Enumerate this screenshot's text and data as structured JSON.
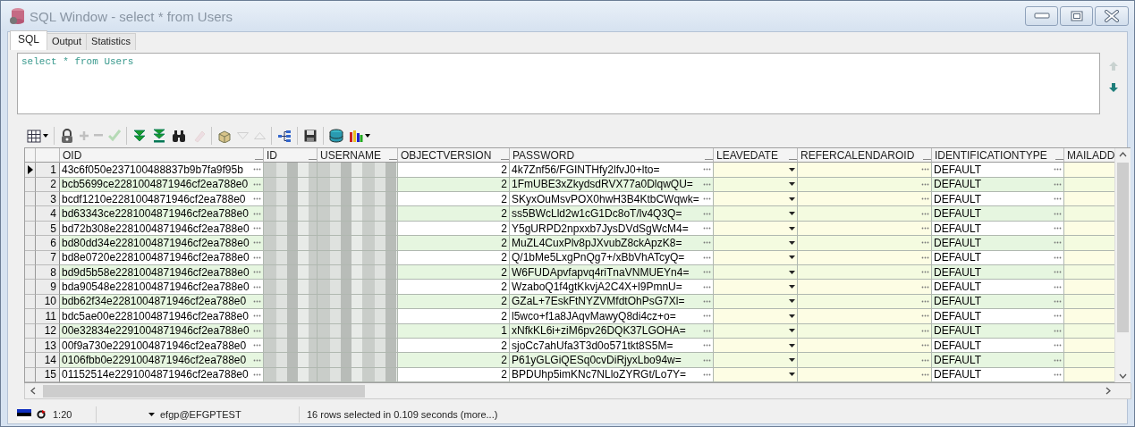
{
  "window": {
    "title": "SQL Window - select * from Users"
  },
  "tabs": [
    {
      "label": "SQL",
      "selected": true
    },
    {
      "label": "Output",
      "selected": false
    },
    {
      "label": "Statistics",
      "selected": false
    }
  ],
  "editor": {
    "value": "select * from Users"
  },
  "toolbar": [
    {
      "kind": "grid",
      "disabled": false
    },
    {
      "kind": "lock",
      "disabled": false
    },
    {
      "kind": "add",
      "disabled": true
    },
    {
      "kind": "remove",
      "disabled": true
    },
    {
      "kind": "post",
      "disabled": true
    },
    {
      "kind": "fetch-next",
      "disabled": false
    },
    {
      "kind": "fetch-last",
      "disabled": false
    },
    {
      "kind": "find",
      "disabled": false
    },
    {
      "kind": "clear",
      "disabled": true
    },
    {
      "kind": "export",
      "disabled": false
    },
    {
      "kind": "down",
      "disabled": true
    },
    {
      "kind": "up",
      "disabled": true
    },
    {
      "kind": "tree",
      "disabled": false
    },
    {
      "kind": "save",
      "disabled": false
    },
    {
      "kind": "database",
      "disabled": false
    },
    {
      "kind": "chart",
      "disabled": false
    }
  ],
  "table": {
    "columns": [
      {
        "label": "OID",
        "kind": "text",
        "ellipsis": true,
        "dropdown": false
      },
      {
        "label": "ID",
        "kind": "redacted",
        "ellipsis": false,
        "dropdown": false
      },
      {
        "label": "USERNAME",
        "kind": "redacted",
        "ellipsis": false,
        "dropdown": false
      },
      {
        "label": "OBJECTVERSION",
        "kind": "number",
        "ellipsis": false,
        "dropdown": false
      },
      {
        "label": "PASSWORD",
        "kind": "text",
        "ellipsis": true,
        "dropdown": false
      },
      {
        "label": "LEAVEDATE",
        "kind": "blank",
        "ellipsis": false,
        "dropdown": true
      },
      {
        "label": "REFERCALENDAROID",
        "kind": "blank",
        "ellipsis": true,
        "dropdown": false
      },
      {
        "label": "IDENTIFICATIONTYPE",
        "kind": "text",
        "ellipsis": true,
        "dropdown": false
      },
      {
        "label": "MAILADD",
        "kind": "blank",
        "ellipsis": false,
        "dropdown": false
      }
    ],
    "rows": [
      {
        "number": "1",
        "current": true,
        "cells": [
          "43c6f050e237100488837b9b7fa9f95b",
          "2",
          "4k7Znf56/FGINTHfy2lfvJ0+lto=",
          "DEFAULT"
        ]
      },
      {
        "number": "2",
        "current": false,
        "cells": [
          "bcb5699ce2281004871946cf2ea788e0",
          "2",
          "1FmUBE3xZkydsdRVX77a0DlqwQU=",
          "DEFAULT"
        ]
      },
      {
        "number": "3",
        "current": false,
        "cells": [
          "bcdf1210e2281004871946cf2ea788e0",
          "2",
          "SKyxOuMsvPOX0hwH3B4KtbCWqwk=",
          "DEFAULT"
        ]
      },
      {
        "number": "4",
        "current": false,
        "cells": [
          "bd63343ce2281004871946cf2ea788e0",
          "2",
          "ss5BWcLld2w1cG1Dc8oT/lv4Q3Q=",
          "DEFAULT"
        ]
      },
      {
        "number": "5",
        "current": false,
        "cells": [
          "bd72b308e2281004871946cf2ea788e0",
          "2",
          "Y5gURPD2npxxb7JysDVdSgWcM4=",
          "DEFAULT"
        ]
      },
      {
        "number": "6",
        "current": false,
        "cells": [
          "bd80dd34e2281004871946cf2ea788e0",
          "2",
          "MuZL4CuxPlv8pJXvubZ8ckApzK8=",
          "DEFAULT"
        ]
      },
      {
        "number": "7",
        "current": false,
        "cells": [
          "bd8e0720e2281004871946cf2ea788e0",
          "2",
          "Q/1bMe5LxgPnQg7+/xBbVhATcyQ=",
          "DEFAULT"
        ]
      },
      {
        "number": "8",
        "current": false,
        "cells": [
          "bd9d5b58e2281004871946cf2ea788e0",
          "2",
          "W6FUDApvfapvq4riTnaVNMUEYn4=",
          "DEFAULT"
        ]
      },
      {
        "number": "9",
        "current": false,
        "cells": [
          "bda90548e2281004871946cf2ea788e0",
          "2",
          "WzaboQ1f4gtKkvjA2C4X+l9PmnU=",
          "DEFAULT"
        ]
      },
      {
        "number": "10",
        "current": false,
        "cells": [
          "bdb62f34e2281004871946cf2ea788e0",
          "2",
          "GZaL+7EskFtNYZVMfdtOhPsG7Xl=",
          "DEFAULT"
        ]
      },
      {
        "number": "11",
        "current": false,
        "cells": [
          "bdc5ae00e2281004871946cf2ea788e0",
          "2",
          "l5wco+f1a8JAqvMawyQ8di4cz+o=",
          "DEFAULT"
        ]
      },
      {
        "number": "12",
        "current": false,
        "cells": [
          "00e32834e2291004871946cf2ea788e0",
          "1",
          "xNfkKL6i+ziM6pv26DQK37LGOHA=",
          "DEFAULT"
        ]
      },
      {
        "number": "13",
        "current": false,
        "cells": [
          "00f9a730e2291004871946cf2ea788e0",
          "2",
          "sjoCc7ahUfa3T3d0o571tkt8S5M=",
          "DEFAULT"
        ]
      },
      {
        "number": "14",
        "current": false,
        "cells": [
          "0106fbb0e2291004871946cf2ea788e0",
          "2",
          "P61yGLGiQESq0cvDiRjyxLbo94w=",
          "DEFAULT"
        ]
      },
      {
        "number": "15",
        "current": false,
        "cells": [
          "01152514e2291004871946cf2ea788e0",
          "2",
          "BPDUhp5imKNc7NLloZYRGt/Lo7Y=",
          "DEFAULT"
        ]
      }
    ]
  },
  "status_bar": {
    "position": "1:20",
    "connection": "efgp@EFGPTEST",
    "message": "16 rows selected in 0.109 seconds (more...)"
  }
}
